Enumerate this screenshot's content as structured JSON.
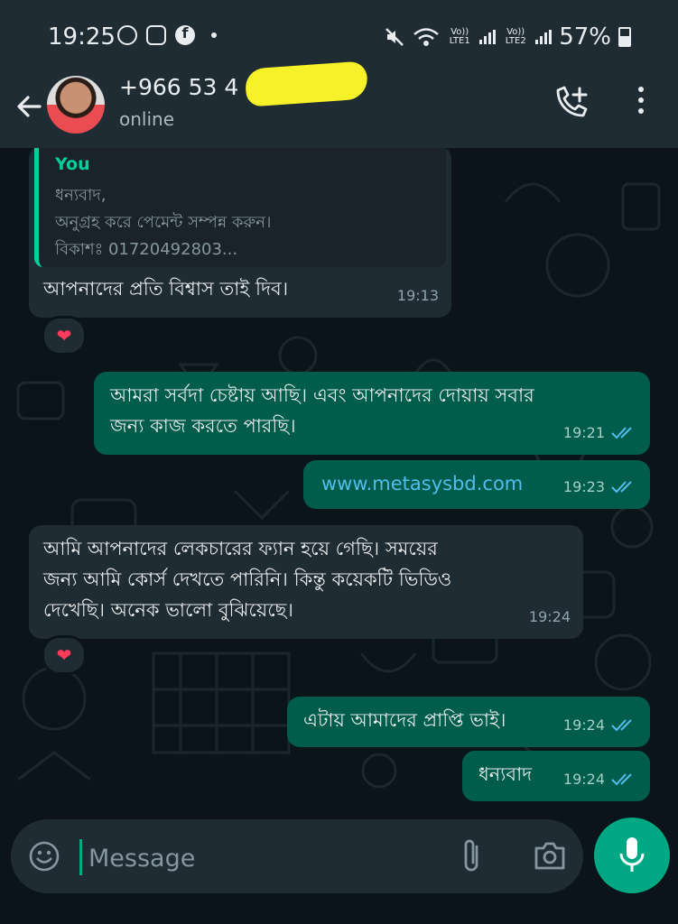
{
  "status_bar": {
    "time": "19:25",
    "sim1_label": "Vo)) LTE1",
    "sim2_label": "Vo)) LTE2",
    "battery": "57%"
  },
  "header": {
    "contact_name": "+966 53 4",
    "status": "online"
  },
  "messages": [
    {
      "direction": "in",
      "quote": {
        "author": "You",
        "lines": [
          "ধন্যবাদ,",
          "অনুগ্রহ করে পেমেন্ট সম্পন্ন করুন।",
          "বিকাশঃ 01720492803..."
        ]
      },
      "text": "আপনাদের প্রতি বিশ্বাস তাই দিব।",
      "time": "19:13",
      "reaction": "❤"
    },
    {
      "direction": "out",
      "lines": [
        "আমরা সর্বদা চেষ্টায় আছি। এবং আপনাদের দোয়ায় সবার",
        "জন্য কাজ করতে পারছি।"
      ],
      "time": "19:21"
    },
    {
      "direction": "out",
      "text": "www.metasysbd.com",
      "time": "19:23"
    },
    {
      "direction": "in",
      "lines": [
        "আমি আপনাদের লেকচারের ফ্যান হয়ে গেছি। সময়ের",
        "জন্য আমি কোর্স দেখতে পারিনি। কিন্তু কয়েকটি ভিডিও",
        "দেখেছি। অনেক ভালো বুঝিয়েছে।"
      ],
      "time": "19:24",
      "reaction": "❤"
    },
    {
      "direction": "out",
      "text": "এটায় আমাদের প্রাপ্তি ভাই।",
      "time": "19:24"
    },
    {
      "direction": "out",
      "text": "ধন্যবাদ",
      "time": "19:24"
    }
  ],
  "composer": {
    "placeholder": "Message"
  },
  "colors": {
    "accent": "#00a884",
    "outgoing_bubble": "#005c4b",
    "incoming_bubble": "#202c33",
    "header": "#1f2c34",
    "read_ticks": "#53bdeb"
  }
}
